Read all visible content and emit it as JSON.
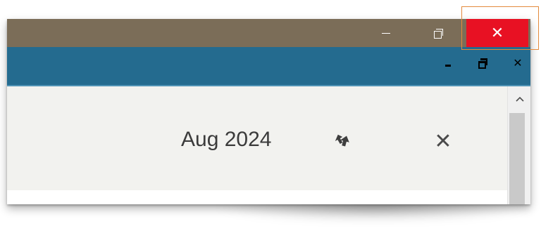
{
  "titlebar": {
    "background": "#7b6d58",
    "buttons": [
      {
        "name": "minimize",
        "icon": "minimize-icon"
      },
      {
        "name": "restore",
        "icon": "restore-icon"
      },
      {
        "name": "close",
        "icon": "close-icon",
        "glyph": "✕",
        "background": "#e81123"
      }
    ],
    "highlight_color": "#e38a3c"
  },
  "mdibar": {
    "background": "#246b8f",
    "buttons": [
      {
        "name": "minimize",
        "icon": "minimize-icon"
      },
      {
        "name": "restore",
        "icon": "restore-icon"
      },
      {
        "name": "close",
        "icon": "close-icon",
        "glyph": "✕"
      }
    ]
  },
  "content": {
    "date_label": "Aug 2024",
    "refresh_icon": "refresh-arrows-icon",
    "dismiss_glyph": "✕"
  },
  "scrollbar": {
    "up_icon": "chevron-up-icon"
  }
}
